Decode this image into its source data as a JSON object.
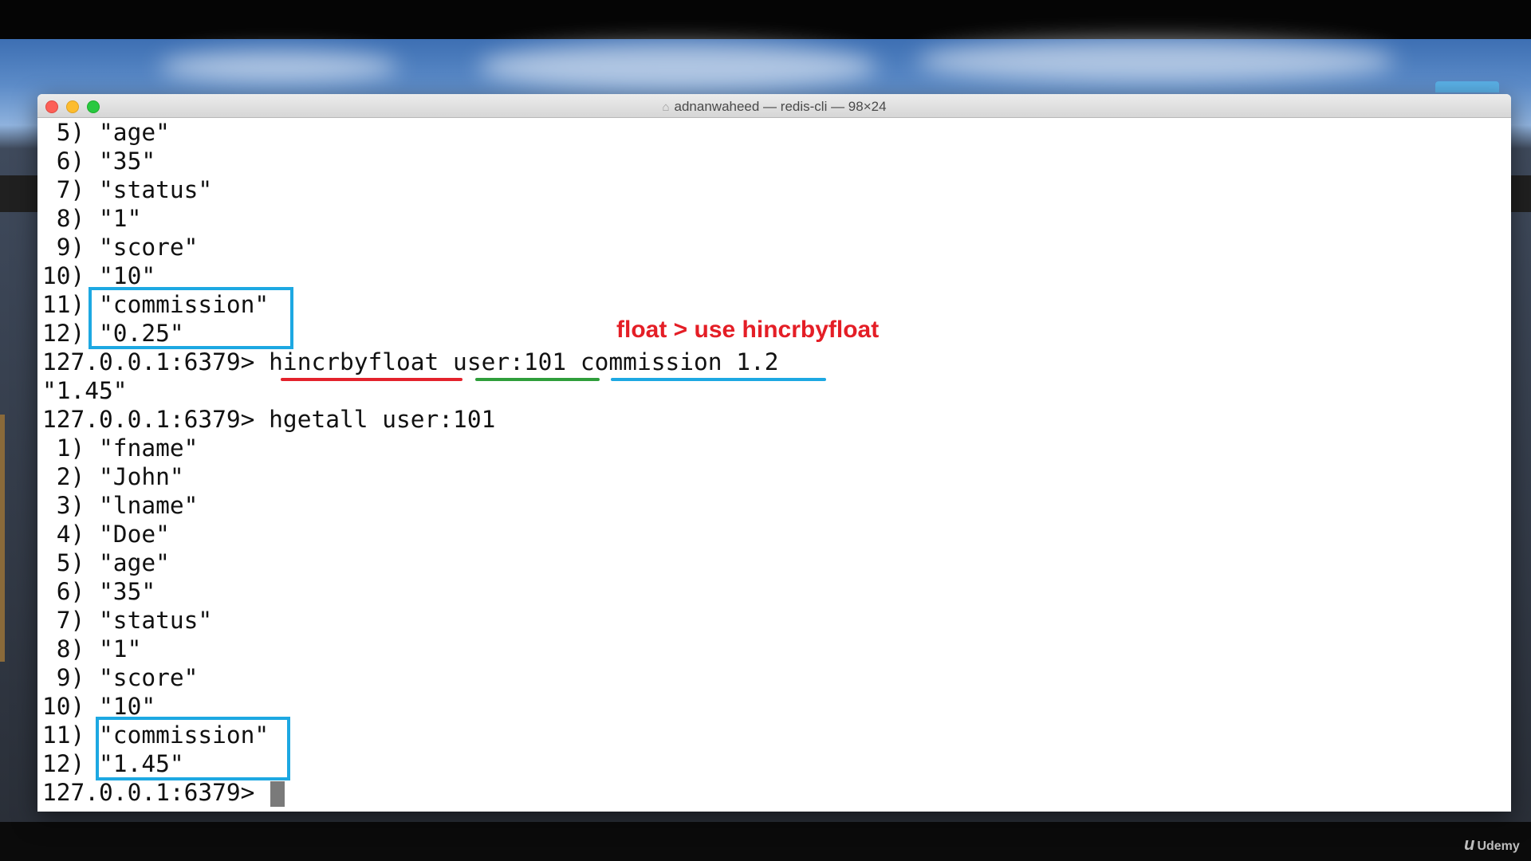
{
  "window": {
    "title": "adnanwaheed — redis-cli — 98×24"
  },
  "terminal": {
    "lines": [
      " 5) \"age\"",
      " 6) \"35\"",
      " 7) \"status\"",
      " 8) \"1\"",
      " 9) \"score\"",
      "10) \"10\"",
      "11) \"commission\"",
      "12) \"0.25\"",
      "127.0.0.1:6379> hincrbyfloat user:101 commission 1.2",
      "\"1.45\"",
      "127.0.0.1:6379> hgetall user:101",
      " 1) \"fname\"",
      " 2) \"John\"",
      " 3) \"lname\"",
      " 4) \"Doe\"",
      " 5) \"age\"",
      " 6) \"35\"",
      " 7) \"status\"",
      " 8) \"1\"",
      " 9) \"score\"",
      "10) \"10\"",
      "11) \"commission\"",
      "12) \"1.45\"",
      "127.0.0.1:6379> "
    ]
  },
  "annotation": {
    "text": "float > use hincrbyfloat"
  },
  "watermark": {
    "text": "Udemy"
  },
  "colors": {
    "annotation_red": "#e41e26",
    "highlight_blue": "#1da8e2",
    "underline_green": "#2f9e3b"
  }
}
